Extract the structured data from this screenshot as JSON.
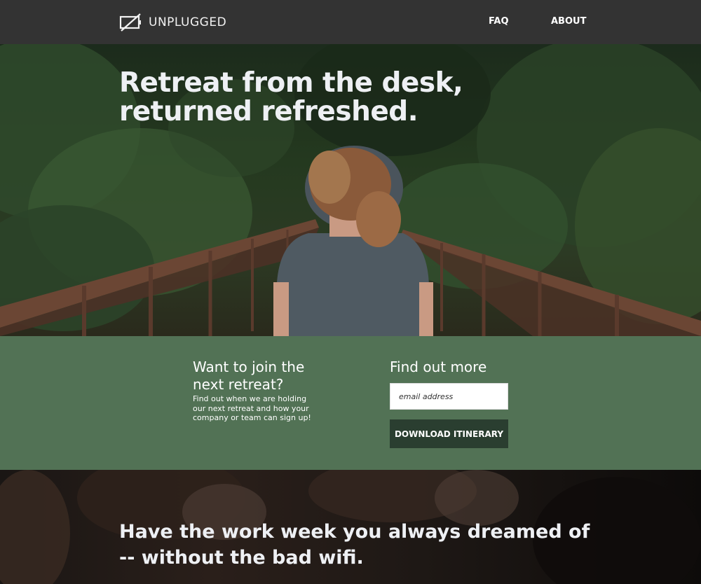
{
  "header": {
    "brand": "UNPLUGGED",
    "nav": {
      "faq": "FAQ",
      "about": "ABOUT"
    }
  },
  "hero": {
    "title_line1": "Retreat from the desk,",
    "title_line2": "returned refreshed."
  },
  "signup": {
    "join_title": "Want to join the next retreat?",
    "join_description": "Find out when we are holding our next retreat and how your company or team can sign up!",
    "find_title": "Find out more",
    "email_placeholder": "email address",
    "download_label": "DOWNLOAD ITINERARY"
  },
  "bottom": {
    "title": "Have the work week you always dreamed of -- without the bad wifi."
  },
  "colors": {
    "header_bg": "#333333",
    "signup_bg": "#527255",
    "button_bg": "#2a3e30"
  },
  "icons": {
    "logo": "unplugged-battery-icon"
  }
}
